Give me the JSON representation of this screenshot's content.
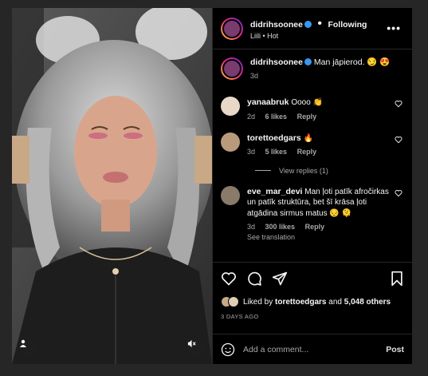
{
  "post": {
    "username": "didrihsoonee",
    "follow_state": "Following",
    "separator": "•",
    "audio": "Liili • Hot",
    "more": "•••",
    "caption": "Man jāpierod.",
    "caption_emojis": "😏 😍",
    "caption_age": "3d"
  },
  "comments": [
    {
      "user": "yanaabruk",
      "text": "Oooo",
      "emoji": "👏",
      "age": "2d",
      "likes": "6 likes",
      "reply": "Reply",
      "avatar_color": "#e8d8c8"
    },
    {
      "user": "torettoedgars",
      "text": "",
      "emoji": "🔥",
      "age": "3d",
      "likes": "5 likes",
      "reply": "Reply",
      "avatar_color": "#b99a7a"
    },
    {
      "user": "eve_mar_devi",
      "text": "Man ļoti patīk afročirkas un patīk struktūra, bet šī krāsa ļoti atgādina sirmus matus",
      "emoji": "😔 🫠",
      "age": "3d",
      "likes": "300 likes",
      "reply": "Reply",
      "see_translation": "See translation",
      "avatar_color": "#8a7a6a"
    }
  ],
  "view_replies": "View replies (1)",
  "likes": {
    "prefix": "Liked by",
    "user": "torettoedgars",
    "and": "and",
    "others": "5,048 others"
  },
  "date": "3 DAYS AGO",
  "add_comment": {
    "placeholder": "Add a comment...",
    "post_label": "Post"
  },
  "colors": {
    "background": "#000000",
    "verified": "#3897f0",
    "muted": "#a8a8a8"
  }
}
